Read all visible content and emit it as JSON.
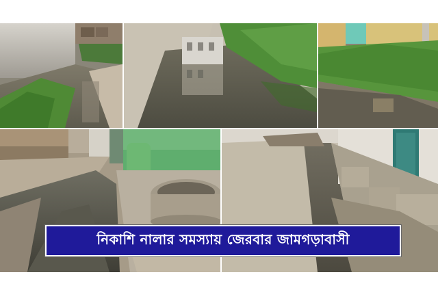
{
  "caption": {
    "text": "নিকাশি নালার সমস্যায় জেরবার জামগড়াবাসী"
  },
  "colors": {
    "caption_background": "#1f1a9a",
    "caption_text": "#ffffff",
    "canvas_background": "#ffffff"
  },
  "photos": [
    {
      "id": "top-left",
      "scene": "waterlogged lane beside a grey wall with grass"
    },
    {
      "id": "top-center",
      "scene": "stagnant water reflecting a house beside tall grass"
    },
    {
      "id": "top-right",
      "scene": "overgrown grass beside a puddle and yellow building"
    },
    {
      "id": "bottom-left",
      "scene": "flooded street with a green painted wall and a concrete well"
    },
    {
      "id": "bottom-right",
      "scene": "open drain channel beside a road and houses"
    }
  ]
}
